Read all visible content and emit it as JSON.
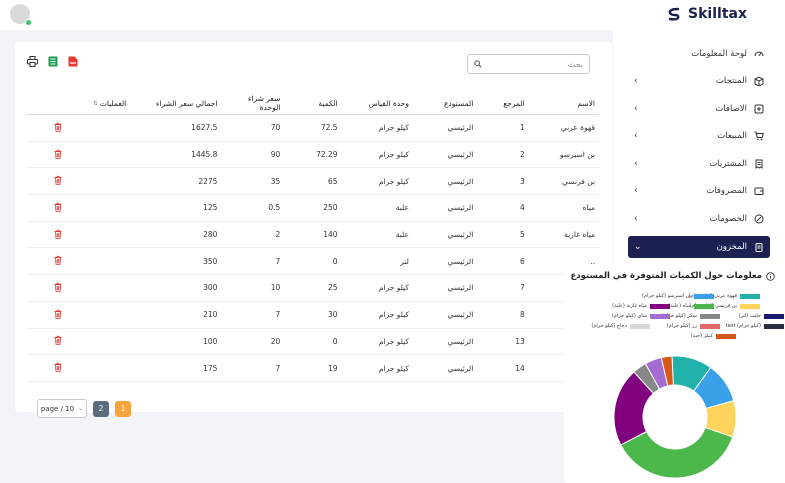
{
  "brand": {
    "name": "Skilltax"
  },
  "sidebar": {
    "items": [
      {
        "label": "لوحة المعلومات",
        "icon": "dashboard-icon",
        "has_chevron": false
      },
      {
        "label": "المنتجات",
        "icon": "box-icon",
        "has_chevron": true
      },
      {
        "label": "الاضافات",
        "icon": "plus-square-icon",
        "has_chevron": true
      },
      {
        "label": "المبيعات",
        "icon": "cart-icon",
        "has_chevron": true
      },
      {
        "label": "المشتريات",
        "icon": "receipt-icon",
        "has_chevron": true
      },
      {
        "label": "المصروفات",
        "icon": "wallet-icon",
        "has_chevron": true
      },
      {
        "label": "الخصومات",
        "icon": "percent-icon",
        "has_chevron": true
      },
      {
        "label": "المخزون",
        "icon": "clipboard-icon",
        "has_chevron": true,
        "active": true
      }
    ]
  },
  "search": {
    "placeholder": "بحث"
  },
  "table": {
    "headers": {
      "name": "الاسم",
      "ref": "المرجع",
      "warehouse": "المستودع",
      "unit": "وحدة القياس",
      "qty": "الكمية",
      "unit_price": "سعر شراء الوحدة",
      "total": "اجمالي سعر الشراء",
      "ops": "العمليات"
    },
    "rows": [
      {
        "name": "قهوة عربي",
        "ref": "1",
        "warehouse": "الرئيسي",
        "unit": "كيلو جرام",
        "qty": "72.5",
        "unit_price": "70",
        "total": "1627.5"
      },
      {
        "name": "بن اسبرسو",
        "ref": "2",
        "warehouse": "الرئيسي",
        "unit": "كيلو جرام",
        "qty": "72.29",
        "unit_price": "90",
        "total": "1445.8"
      },
      {
        "name": "بن فرنسي",
        "ref": "3",
        "warehouse": "الرئيسي",
        "unit": "كيلو جرام",
        "qty": "65",
        "unit_price": "35",
        "total": "2275"
      },
      {
        "name": "مياه",
        "ref": "4",
        "warehouse": "الرئيسي",
        "unit": "علبة",
        "qty": "250",
        "unit_price": "0.5",
        "total": "125"
      },
      {
        "name": "مياه غازية",
        "ref": "5",
        "warehouse": "الرئيسي",
        "unit": "علبة",
        "qty": "140",
        "unit_price": "2",
        "total": "280"
      },
      {
        "name": "..",
        "ref": "6",
        "warehouse": "الرئيسي",
        "unit": "لتر",
        "qty": "0",
        "unit_price": "7",
        "total": "350"
      },
      {
        "name": "",
        "ref": "7",
        "warehouse": "الرئيسي",
        "unit": "كيلو جرام",
        "qty": "25",
        "unit_price": "10",
        "total": "300"
      },
      {
        "name": "",
        "ref": "8",
        "warehouse": "الرئيسي",
        "unit": "كيلو جرام",
        "qty": "30",
        "unit_price": "7",
        "total": "210"
      },
      {
        "name": "",
        "ref": "13",
        "warehouse": "الرئيسي",
        "unit": "كيلو جرام",
        "qty": "0",
        "unit_price": "20",
        "total": "100"
      },
      {
        "name": "",
        "ref": "14",
        "warehouse": "الرئيسي",
        "unit": "كيلو جرام",
        "qty": "19",
        "unit_price": "7",
        "total": "175"
      }
    ]
  },
  "pagination": {
    "page_size_label": "page / 10",
    "pages": [
      "2",
      "1"
    ],
    "current": "1"
  },
  "panel": {
    "title": "معلومات حول الكميات المتوفرة في المستودع"
  },
  "chart_data": {
    "type": "pie",
    "variant": "doughnut",
    "title": "معلومات حول الكميات المتوفرة في المستودع",
    "series": [
      {
        "name": "قهوة عربي (كيلو جرام)",
        "value": 72.5,
        "color": "#20b2aa"
      },
      {
        "name": "بن اسبرسو (كيلو جرام)",
        "value": 72.29,
        "color": "#3aa0e8"
      },
      {
        "name": "بن فرنسي (كيلو جرام)",
        "value": 65,
        "color": "#ffd35c"
      },
      {
        "name": "مياه (علبة)",
        "value": 250,
        "color": "#4cb84c"
      },
      {
        "name": "مياه غازية (علبة)",
        "value": 140,
        "color": "#800080"
      },
      {
        "name": "حليب (لتر)",
        "value": 0,
        "color": "#1a1a6e"
      },
      {
        "name": "سكر (كيلو جرام)",
        "value": 25,
        "color": "#888888"
      },
      {
        "name": "شاي (كيلو جرام)",
        "value": 30,
        "color": "#a46bd0"
      },
      {
        "name": "test (كيلو جرام)",
        "value": 0,
        "color": "#2a2f3f"
      },
      {
        "name": "رز (كيلو جرام)",
        "value": 0,
        "color": "#e06868"
      },
      {
        "name": "دجاج (كيلو جرام)",
        "value": 0,
        "color": "#d8d8d8"
      },
      {
        "name": "كيكز (حبة)",
        "value": 19,
        "color": "#d4591a"
      }
    ]
  }
}
